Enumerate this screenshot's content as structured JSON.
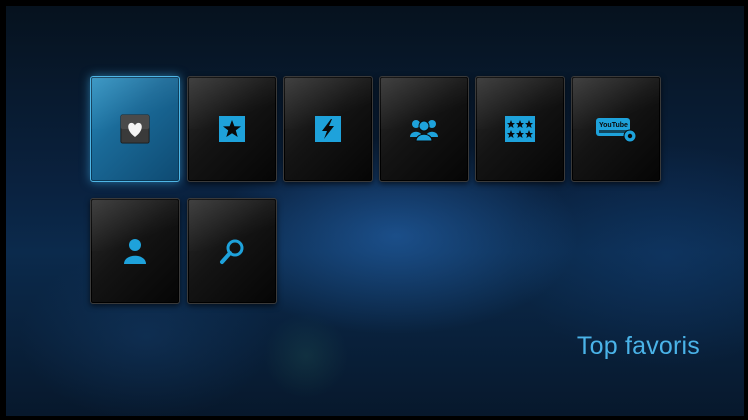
{
  "menu": {
    "tiles": [
      {
        "id": "favorites",
        "icon": "heart-icon",
        "selected": true
      },
      {
        "id": "starred",
        "icon": "star-icon",
        "selected": false
      },
      {
        "id": "flash",
        "icon": "lightning-icon",
        "selected": false
      },
      {
        "id": "groups",
        "icon": "people-icon",
        "selected": false
      },
      {
        "id": "ratings",
        "icon": "rating-stars-icon",
        "selected": false
      },
      {
        "id": "youtube",
        "icon": "youtube-settings-icon",
        "selected": false
      },
      {
        "id": "account",
        "icon": "user-icon",
        "selected": false
      },
      {
        "id": "search",
        "icon": "search-icon",
        "selected": false
      }
    ],
    "caption": "Top favoris",
    "youtube_logo_text": "YouTube"
  },
  "colors": {
    "accent": "#1ea2db",
    "caption": "#4ab3e8",
    "selected_tile": "#2a8fc0"
  }
}
